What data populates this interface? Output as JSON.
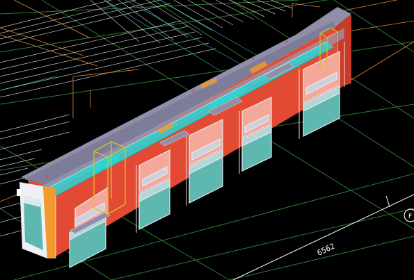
{
  "viewport": {
    "background": "#000000",
    "grid_color": "#2e7d32",
    "colors": {
      "roof": "#8f8faa",
      "wall": "#e24a33",
      "wall_dark": "#b23520",
      "glass": "#5fb8b0",
      "glass_frame": "#e8e8ee",
      "duct": "#2ed3d3",
      "yellow": "#d8c02a",
      "orange": "#f29a2e",
      "wire": "#f2f2f2",
      "wire_orange": "#e08a3a"
    }
  },
  "dimension": {
    "value": "6562"
  },
  "grid_marker": {
    "label": "F"
  }
}
